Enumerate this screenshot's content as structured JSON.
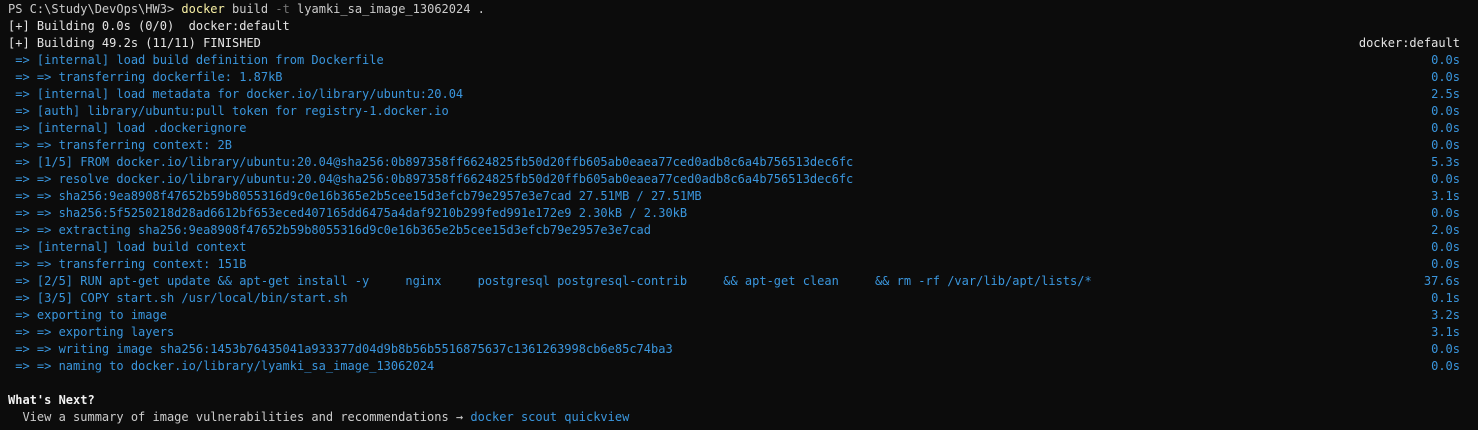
{
  "prompt": {
    "path": "PS C:\\Study\\DevOps\\HW3>",
    "command": "docker",
    "sub": "build",
    "flag": "-t",
    "args": "lyamki_sa_image_13062024 ."
  },
  "progress": {
    "line1": "[+] Building 0.0s (0/0)  docker:default",
    "line2": "[+] Building 49.2s (11/11) FINISHED",
    "line2_right": "docker:default"
  },
  "steps": [
    {
      "text": " => [internal] load build definition from Dockerfile",
      "time": "0.0s"
    },
    {
      "text": " => => transferring dockerfile: 1.87kB",
      "time": "0.0s"
    },
    {
      "text": " => [internal] load metadata for docker.io/library/ubuntu:20.04",
      "time": "2.5s"
    },
    {
      "text": " => [auth] library/ubuntu:pull token for registry-1.docker.io",
      "time": "0.0s"
    },
    {
      "text": " => [internal] load .dockerignore",
      "time": "0.0s"
    },
    {
      "text": " => => transferring context: 2B",
      "time": "0.0s"
    },
    {
      "text": " => [1/5] FROM docker.io/library/ubuntu:20.04@sha256:0b897358ff6624825fb50d20ffb605ab0eaea77ced0adb8c6a4b756513dec6fc",
      "time": "5.3s"
    },
    {
      "text": " => => resolve docker.io/library/ubuntu:20.04@sha256:0b897358ff6624825fb50d20ffb605ab0eaea77ced0adb8c6a4b756513dec6fc",
      "time": "0.0s"
    },
    {
      "text": " => => sha256:9ea8908f47652b59b8055316d9c0e16b365e2b5cee15d3efcb79e2957e3e7cad 27.51MB / 27.51MB",
      "time": "3.1s"
    },
    {
      "text": " => => sha256:5f5250218d28ad6612bf653eced407165dd6475a4daf9210b299fed991e172e9 2.30kB / 2.30kB",
      "time": "0.0s"
    },
    {
      "text": " => => extracting sha256:9ea8908f47652b59b8055316d9c0e16b365e2b5cee15d3efcb79e2957e3e7cad",
      "time": "2.0s"
    },
    {
      "text": " => [internal] load build context",
      "time": "0.0s"
    },
    {
      "text": " => => transferring context: 151B",
      "time": "0.0s"
    },
    {
      "text": " => [2/5] RUN apt-get update && apt-get install -y     nginx     postgresql postgresql-contrib     && apt-get clean     && rm -rf /var/lib/apt/lists/*",
      "time": "37.6s"
    },
    {
      "text": " => [3/5] COPY start.sh /usr/local/bin/start.sh",
      "time": "0.1s"
    },
    {
      "text": " => exporting to image",
      "time": "3.2s"
    },
    {
      "text": " => => exporting layers",
      "time": "3.1s"
    },
    {
      "text": " => => writing image sha256:1453b76435041a933377d04d9b8b56b5516875637c1361263998cb6e85c74ba3",
      "time": "0.0s"
    },
    {
      "text": " => => naming to docker.io/library/lyamki_sa_image_13062024",
      "time": "0.0s"
    }
  ],
  "next": {
    "heading": "What's Next?",
    "summary": "  View a summary of image vulnerabilities and recommendations → ",
    "command": "docker scout quickview"
  }
}
